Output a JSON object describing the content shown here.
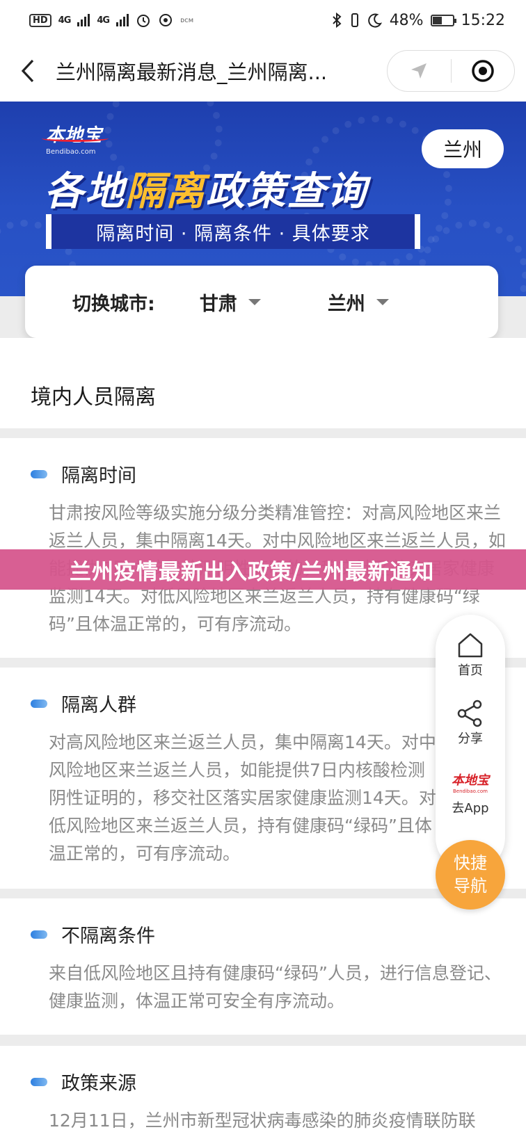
{
  "status_bar": {
    "hd": "HD",
    "net1": "4G",
    "net2": "4G",
    "battery": "48%",
    "time": "15:22",
    "tiny": "ᴅᴄᴍ"
  },
  "nav": {
    "title": "兰州隔离最新消息_兰州隔离..."
  },
  "banner": {
    "logo_cn": "本地宝",
    "logo_en": "Bendibao.com",
    "city": "兰州",
    "title_pre": "各地",
    "title_hl": "隔离",
    "title_post": "政策查询",
    "subtitle": "隔离时间 · 隔离条件 · 具体要求"
  },
  "city_selector": {
    "label": "切换城市:",
    "province": "甘肃",
    "city": "兰州"
  },
  "section_title": "境内人员隔离",
  "blocks": [
    {
      "title": "隔离时间",
      "body": "甘肃按风险等级实施分级分类精准管控：对高风险地区来兰返兰人员，集中隔离14天。对中风险地区来兰返兰人员，如能提供7日内核酸检测阴性证明的，移交社区落实居家健康监测14天。对低风险地区来兰返兰人员，持有健康码“绿码”且体温正常的，可有序流动。"
    },
    {
      "title": "隔离人群",
      "body": "对高风险地区来兰返兰人员，集中隔离14天。对中风险地区来兰返兰人员，如能提供7日内核酸检测阴性证明的，移交社区落实居家健康监测14天。对低风险地区来兰返兰人员，持有健康码“绿码”且体温正常的，可有序流动。"
    },
    {
      "title": "不隔离条件",
      "body": "来自低风险地区且持有健康码“绿码”人员，进行信息登记、健康监测，体温正常可安全有序流动。"
    },
    {
      "title": "政策来源",
      "body": "12月11日，兰州市新型冠状病毒感染的肺炎疫情联防联"
    }
  ],
  "caption": "兰州疫情最新出入政策/兰州最新通知",
  "side_toolbar": {
    "home": "首页",
    "share": "分享",
    "app_logo": "本地宝",
    "app_logo_sub": "Bendibao.com",
    "app": "去App",
    "quick_nav_1": "快捷",
    "quick_nav_2": "导航"
  },
  "colors": {
    "banner_blue": "#2750c4",
    "highlight_yellow": "#ffbf2e",
    "caption_pink": "#d6558c",
    "quick_nav_orange": "#f7a53c",
    "dot_blue": "#2d7fe0"
  }
}
